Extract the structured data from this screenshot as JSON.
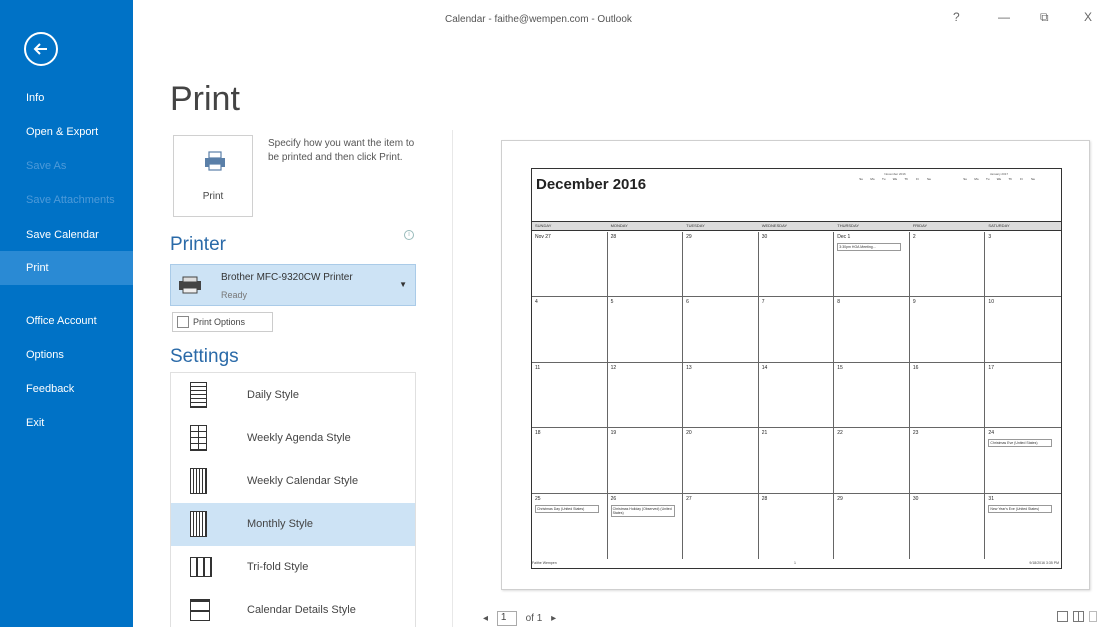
{
  "window": {
    "title": "Calendar - faithe@wempen.com - Outlook",
    "controls": {
      "help": "?",
      "minimize": "—",
      "restore": "⧉",
      "close": "X"
    }
  },
  "sidebar": {
    "items": [
      {
        "label": "Info",
        "state": "normal"
      },
      {
        "label": "Open & Export",
        "state": "normal"
      },
      {
        "label": "Save As",
        "state": "disabled"
      },
      {
        "label": "Save Attachments",
        "state": "disabled"
      },
      {
        "label": "Save Calendar",
        "state": "normal"
      },
      {
        "label": "Print",
        "state": "active"
      },
      {
        "label": "Office Account",
        "state": "normal"
      },
      {
        "label": "Options",
        "state": "normal"
      },
      {
        "label": "Feedback",
        "state": "normal"
      },
      {
        "label": "Exit",
        "state": "normal"
      }
    ]
  },
  "print": {
    "page_title": "Print",
    "button_label": "Print",
    "description": "Specify how you want the item to be printed and then click Print.",
    "printer_heading": "Printer",
    "printer_name": "Brother MFC-9320CW Printer",
    "printer_status": "Ready",
    "print_options_label": "Print Options",
    "settings_heading": "Settings",
    "styles": [
      {
        "label": "Daily Style",
        "icon": "daily-style-icon",
        "selected": false
      },
      {
        "label": "Weekly Agenda Style",
        "icon": "weekly-agenda-style-icon",
        "selected": false
      },
      {
        "label": "Weekly Calendar Style",
        "icon": "weekly-calendar-style-icon",
        "selected": false
      },
      {
        "label": "Monthly Style",
        "icon": "monthly-style-icon",
        "selected": true
      },
      {
        "label": "Tri-fold Style",
        "icon": "trifold-style-icon",
        "selected": false
      },
      {
        "label": "Calendar Details Style",
        "icon": "calendar-details-style-icon",
        "selected": false
      }
    ]
  },
  "preview": {
    "month_title": "December 2016",
    "mini_cal_1": {
      "title": "November 2016",
      "days": [
        "Su",
        "Mo",
        "Tu",
        "We",
        "Th",
        "Fr",
        "Sa"
      ]
    },
    "mini_cal_2": {
      "title": "January 2017",
      "days": [
        "Su",
        "Mo",
        "Tu",
        "We",
        "Th",
        "Fr",
        "Sa"
      ]
    },
    "weekdays": [
      "SUNDAY",
      "MONDAY",
      "TUESDAY",
      "WEDNESDAY",
      "THURSDAY",
      "FRIDAY",
      "SATURDAY"
    ],
    "weeks": [
      [
        "Nov 27",
        "28",
        "29",
        "30",
        "Dec 1",
        "2",
        "3"
      ],
      [
        "4",
        "5",
        "6",
        "7",
        "8",
        "9",
        "10"
      ],
      [
        "11",
        "12",
        "13",
        "14",
        "15",
        "16",
        "17"
      ],
      [
        "18",
        "19",
        "20",
        "21",
        "22",
        "23",
        "24"
      ],
      [
        "25",
        "26",
        "27",
        "28",
        "29",
        "30",
        "31"
      ]
    ],
    "events": [
      {
        "week": 0,
        "day": 4,
        "text": "3:30pm HOA Meeting..."
      },
      {
        "week": 3,
        "day": 6,
        "text": "Christmas Eve (United States)"
      },
      {
        "week": 4,
        "day": 0,
        "text": "Christmas Day (United States)"
      },
      {
        "week": 4,
        "day": 1,
        "text": "Christmas Holiday (Observed) (United States)"
      },
      {
        "week": 4,
        "day": 6,
        "text": "New Year's Eve (United States)"
      }
    ],
    "footer_left": "Faithe Wempen",
    "footer_mid": "1",
    "footer_right": "9/18/2016 3:35 PM"
  },
  "pager": {
    "prev": "◂",
    "page": "1",
    "of_label": "of 1",
    "next": "▸"
  }
}
